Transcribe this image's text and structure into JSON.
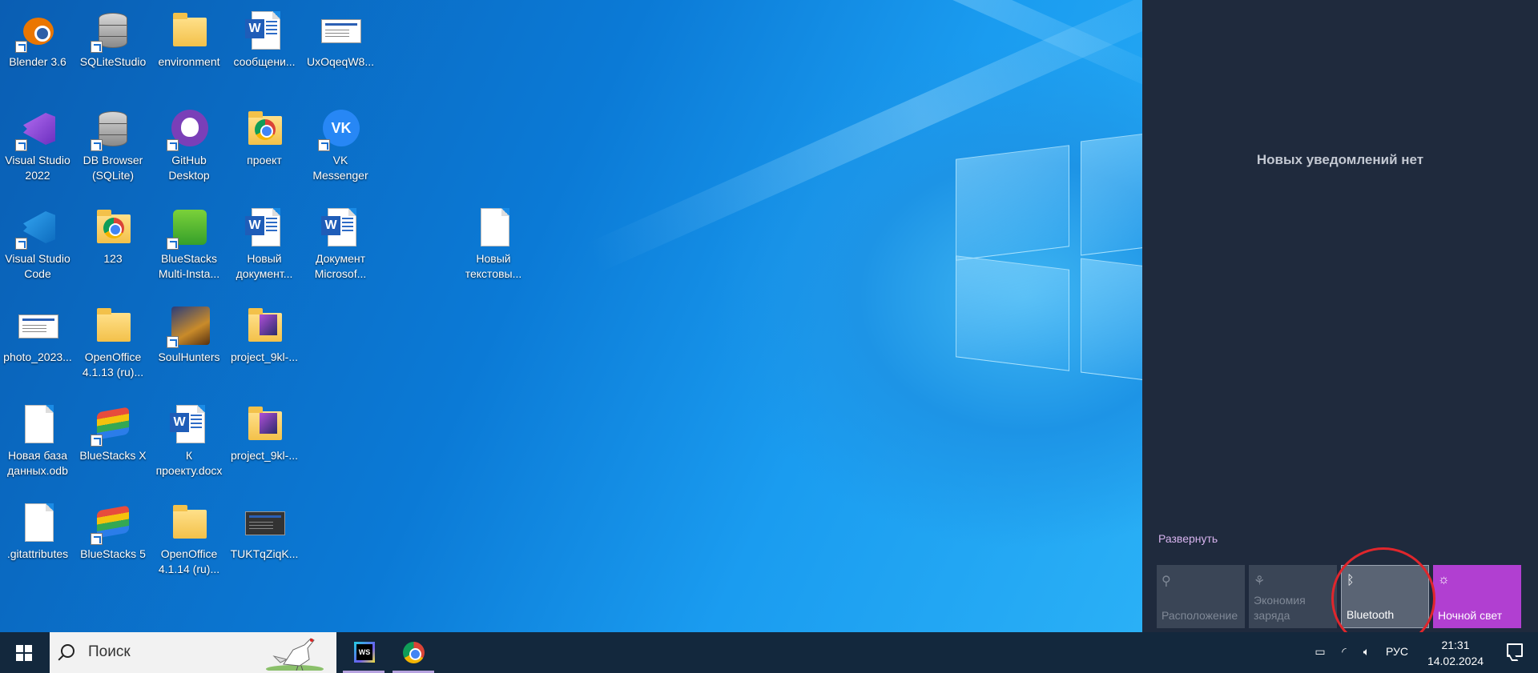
{
  "desktop": {
    "icons": [
      {
        "label": "Blender 3.6",
        "icon": "blender-icon"
      },
      {
        "label": "SQLiteStudio",
        "icon": "database-icon"
      },
      {
        "label": "environment",
        "icon": "folder-icon"
      },
      {
        "label": "сообщени...",
        "icon": "word-document-icon"
      },
      {
        "label": "UxOqeqW8...",
        "icon": "image-file-icon"
      },
      {
        "label": "Visual Studio 2022",
        "icon": "visual-studio-icon"
      },
      {
        "label": "DB Browser (SQLite)",
        "icon": "database-icon"
      },
      {
        "label": "GitHub Desktop",
        "icon": "github-icon"
      },
      {
        "label": "проект",
        "icon": "folder-icon"
      },
      {
        "label": "VK Messenger",
        "icon": "vk-icon"
      },
      {
        "label": "Visual Studio Code",
        "icon": "vscode-icon"
      },
      {
        "label": "123",
        "icon": "chrome-folder-icon"
      },
      {
        "label": "BlueStacks Multi-Insta...",
        "icon": "bluestacks-multi-icon"
      },
      {
        "label": "Новый документ...",
        "icon": "word-document-icon"
      },
      {
        "label": "Документ Microsof...",
        "icon": "word-document-icon"
      },
      {
        "label": "Новый текстовы...",
        "icon": "text-file-icon"
      },
      {
        "label": "photo_2023...",
        "icon": "image-file-icon"
      },
      {
        "label": "OpenOffice 4.1.13 (ru)...",
        "icon": "folder-icon"
      },
      {
        "label": "SoulHunters",
        "icon": "game-icon"
      },
      {
        "label": "project_9kl-...",
        "icon": "phpstorm-folder-icon"
      },
      {
        "label": "Новая база данных.odb",
        "icon": "odb-file-icon"
      },
      {
        "label": "BlueStacks X",
        "icon": "bluestacks-icon"
      },
      {
        "label": "К проекту.docx",
        "icon": "word-document-icon"
      },
      {
        "label": "project_9kl-...",
        "icon": "phpstorm-folder-icon"
      },
      {
        "label": ".gitattributes",
        "icon": "text-file-icon"
      },
      {
        "label": "BlueStacks 5",
        "icon": "bluestacks-icon"
      },
      {
        "label": "OpenOffice 4.1.14 (ru)...",
        "icon": "folder-icon"
      },
      {
        "label": "TUKTqZiqK...",
        "icon": "image-file-icon"
      }
    ]
  },
  "action_center": {
    "empty_message": "Новых уведомлений нет",
    "expand_label": "Развернуть",
    "quick_actions": [
      {
        "label": "Расположение",
        "icon": "location-icon",
        "state": "off"
      },
      {
        "label": "Экономия заряда",
        "icon": "battery-saver-icon",
        "state": "off"
      },
      {
        "label": "Bluetooth",
        "icon": "bluetooth-icon",
        "state": "off"
      },
      {
        "label": "Ночной свет",
        "icon": "night-light-icon",
        "state": "on"
      }
    ],
    "accent_color": "#b13fd1"
  },
  "taskbar": {
    "search_placeholder": "Поиск",
    "language": "РУС",
    "time": "21:31",
    "date": "14.02.2024"
  }
}
